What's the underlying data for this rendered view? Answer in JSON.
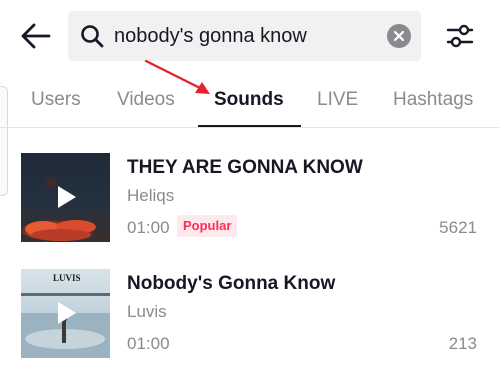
{
  "search": {
    "query": "nobody's gonna know"
  },
  "tabs": [
    {
      "label": "Users"
    },
    {
      "label": "Videos"
    },
    {
      "label": "Sounds"
    },
    {
      "label": "LIVE"
    },
    {
      "label": "Hashtags"
    }
  ],
  "active_tab": "Sounds",
  "sounds": [
    {
      "title": "THEY ARE GONNA KNOW",
      "artist": "Heliqs",
      "duration": "01:00",
      "badge": "Popular",
      "count": "5621"
    },
    {
      "title": "Nobody's Gonna Know",
      "artist": "Luvis",
      "duration": "01:00",
      "badge": "",
      "count": "213",
      "cover_text_top": "LUVIS"
    }
  ],
  "colors": {
    "accent": "#fe2c55",
    "badge_bg": "#fde8ec",
    "secondary_text": "#8a8b91",
    "primary_text": "#161823",
    "search_bg": "#f1f1f2",
    "annotation_arrow": "#e8202a"
  },
  "icons": {
    "back": "arrow-left-icon",
    "search": "search-icon",
    "clear": "clear-circle-x-icon",
    "filter": "sliders-filter-icon",
    "play": "play-icon"
  }
}
